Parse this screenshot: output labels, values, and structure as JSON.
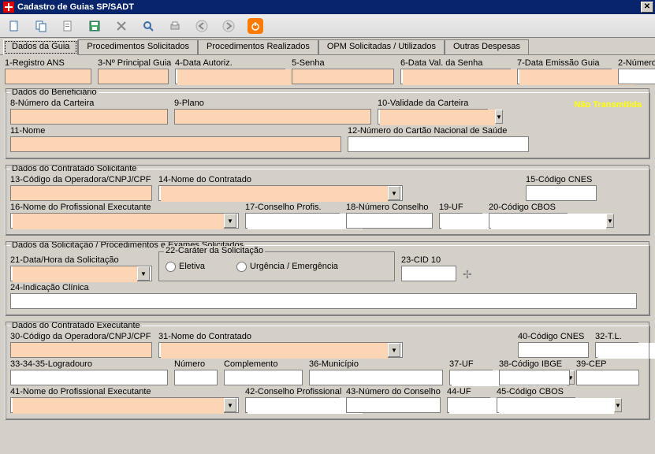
{
  "title": "Cadastro de Guias SP/SADT",
  "tabs": [
    "Dados da Guia",
    "Procedimentos Solicitados",
    "Procedimentos Realizados",
    "OPM Solicitadas / Utilizados",
    "Outras Despesas"
  ],
  "group1": {
    "f1": "1-Registro ANS",
    "f3": "3-Nº Principal Guia",
    "f4": "4-Data Autoriz.",
    "f5": "5-Senha",
    "f6": "6-Data Val. da Senha",
    "f7": "7-Data Emissão Guia",
    "f2": "2-Número"
  },
  "benef": {
    "legend": "Dados do Beneficiário",
    "f8": "8-Número da Carteira",
    "f9": "9-Plano",
    "f10": "10-Validade da Carteira",
    "status": "Não Transmitida",
    "f11": "11-Nome",
    "f12": "12-Número do Cartão Nacional de Saúde"
  },
  "solic": {
    "legend": "Dados do Contratado Solicitante",
    "f13": "13-Código da Operadora/CNPJ/CPF",
    "f14": "14-Nome do Contratado",
    "f15": "15-Código CNES",
    "f16": "16-Nome do Profissional Executante",
    "f17": "17-Conselho Profis.",
    "f18": "18-Número Conselho",
    "f19": "19-UF",
    "f20": "20-Código CBOS"
  },
  "solproc": {
    "legend": "Dados da Solicitação / Procedimentos e Exames Solicitados",
    "f21": "21-Data/Hora da Solicitação",
    "f22": "22-Caráter da Solicitação",
    "r1": "Eletiva",
    "r2": "Urgência / Emergência",
    "f23": "23-CID 10",
    "f24": "24-Indicação Clínica"
  },
  "exec": {
    "legend": "Dados do Contratado Executante",
    "f30": "30-Código da Operadora/CNPJ/CPF",
    "f31": "31-Nome do Contratado",
    "f40": "40-Código CNES",
    "f32": "32-T.L.",
    "f33": "33-34-35-Logradouro",
    "fnum": "Número",
    "fcomp": "Complemento",
    "f36": "36-Município",
    "f37": "37-UF",
    "f38": "38-Código IBGE",
    "f39": "39-CEP",
    "f41": "41-Nome do Profissional Executante",
    "f42": "42-Conselho Profissional",
    "f43": "43-Número do Conselho",
    "f44": "44-UF",
    "f45": "45-Código CBOS"
  }
}
